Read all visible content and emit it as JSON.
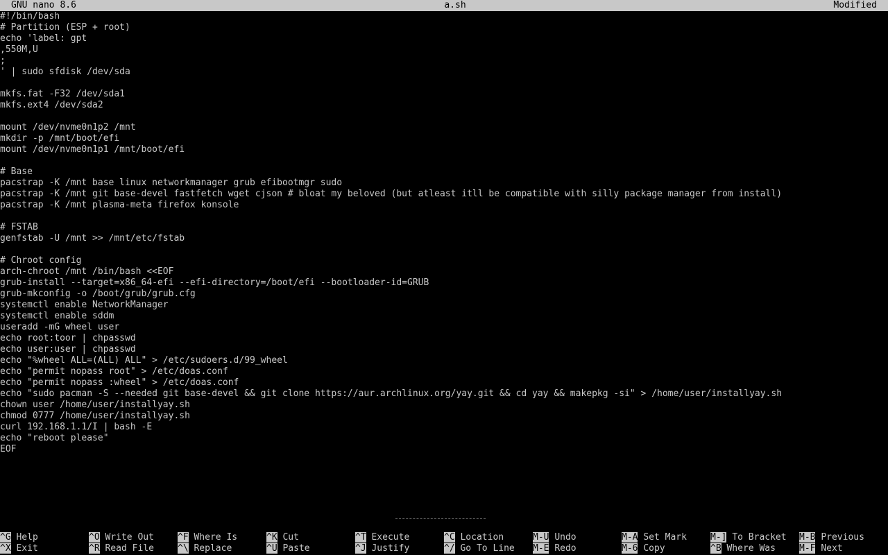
{
  "titlebar": {
    "app": "GNU nano 8.6",
    "filename": "a.sh",
    "state": "Modified"
  },
  "editor": {
    "lines": [
      "#!/bin/bash",
      "# Partition (ESP + root)",
      "echo 'label: gpt",
      ",550M,U",
      ";",
      "' | sudo sfdisk /dev/sda",
      "",
      "mkfs.fat -F32 /dev/sda1",
      "mkfs.ext4 /dev/sda2",
      "",
      "mount /dev/nvme0n1p2 /mnt",
      "mkdir -p /mnt/boot/efi",
      "mount /dev/nvme0n1p1 /mnt/boot/efi",
      "",
      "# Base",
      "pacstrap -K /mnt base linux networkmanager grub efibootmgr sudo",
      "pacstrap -K /mnt git base-devel fastfetch wget cjson # bloat my beloved (but atleast itll be compatible with silly package manager from install)",
      "pacstrap -K /mnt plasma-meta firefox konsole",
      "",
      "# FSTAB",
      "genfstab -U /mnt >> /mnt/etc/fstab",
      "",
      "# Chroot config",
      "arch-chroot /mnt /bin/bash <<EOF",
      "grub-install --target=x86_64-efi --efi-directory=/boot/efi --bootloader-id=GRUB",
      "grub-mkconfig -o /boot/grub/grub.cfg",
      "systemctl enable NetworkManager",
      "systemctl enable sddm",
      "useradd -mG wheel user",
      "echo root:toor | chpasswd",
      "echo user:user | chpasswd",
      "echo \"%wheel ALL=(ALL) ALL\" > /etc/sudoers.d/99_wheel",
      "echo \"permit nopass root\" > /etc/doas.conf",
      "echo \"permit nopass :wheel\" > /etc/doas.conf",
      "echo \"sudo pacman -S --needed git base-devel && git clone https://aur.archlinux.org/yay.git && cd yay && makepkg -si\" > /home/user/installyay.sh",
      "chown user /home/user/installyay.sh",
      "chmod 0777 /home/user/installyay.sh",
      "curl 192.168.1.1/I | bash -E",
      "echo \"reboot please\"",
      "EOF"
    ]
  },
  "help": {
    "top": [
      {
        "key": "^G",
        "label": "Help"
      },
      {
        "key": "^O",
        "label": "Write Out"
      },
      {
        "key": "^F",
        "label": "Where Is"
      },
      {
        "key": "^K",
        "label": "Cut"
      },
      {
        "key": "^T",
        "label": "Execute"
      },
      {
        "key": "^C",
        "label": "Location"
      },
      {
        "key": "M-U",
        "label": "Undo"
      },
      {
        "key": "M-A",
        "label": "Set Mark"
      },
      {
        "key": "M-]",
        "label": "To Bracket"
      },
      {
        "key": "M-B",
        "label": "Previous"
      }
    ],
    "bottom": [
      {
        "key": "^X",
        "label": "Exit"
      },
      {
        "key": "^R",
        "label": "Read File"
      },
      {
        "key": "^\\",
        "label": "Replace"
      },
      {
        "key": "^U",
        "label": "Paste"
      },
      {
        "key": "^J",
        "label": "Justify"
      },
      {
        "key": "^/",
        "label": "Go To Line"
      },
      {
        "key": "M-E",
        "label": "Redo"
      },
      {
        "key": "M-6",
        "label": "Copy"
      },
      {
        "key": "^B",
        "label": "Where Was"
      },
      {
        "key": "M-F",
        "label": "Next"
      }
    ]
  },
  "colors": {
    "background": "#000000",
    "foreground": "#c8c8c8",
    "inverse_bg": "#c8c8c8",
    "inverse_fg": "#000000"
  }
}
